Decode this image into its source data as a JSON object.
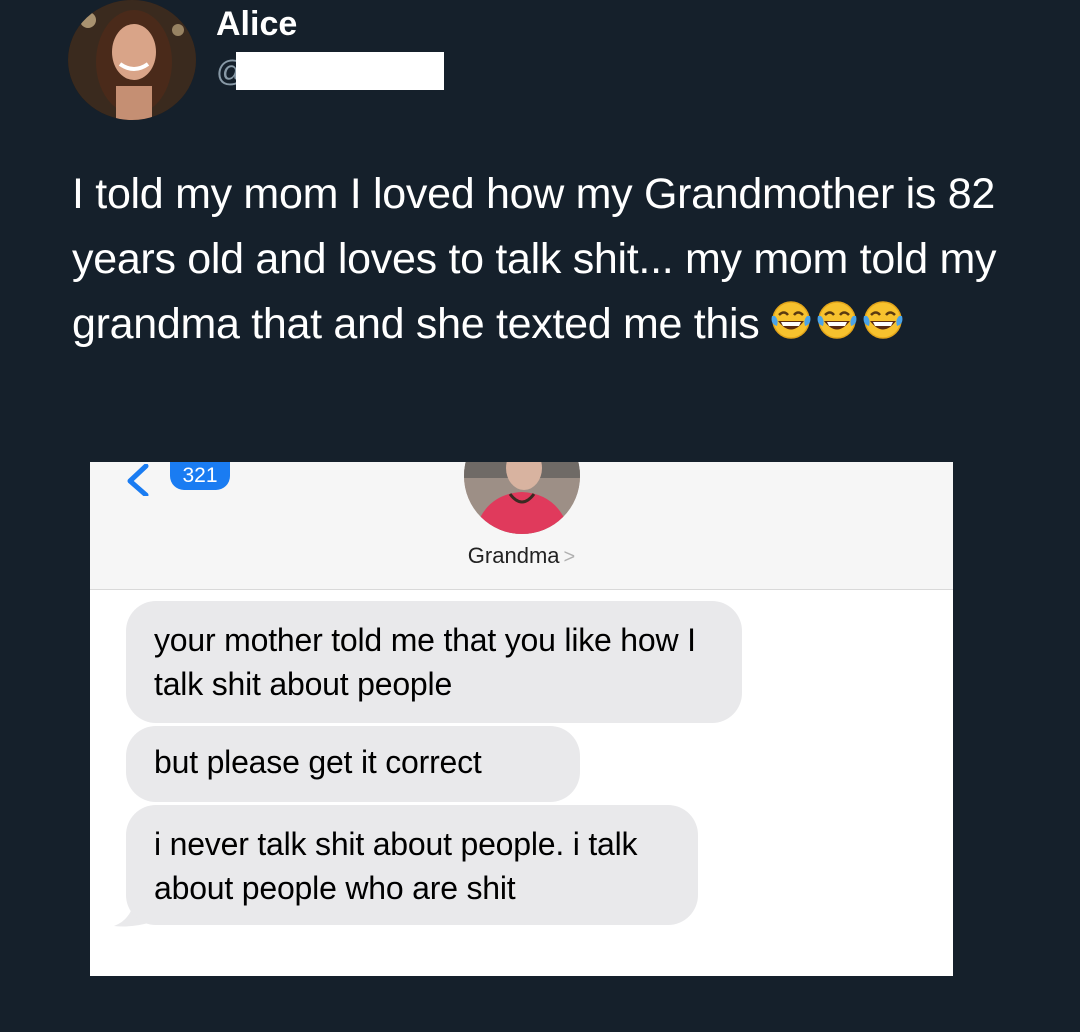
{
  "tweet": {
    "display_name": "Alice",
    "handle_prefix": "@",
    "text": "I told my mom I loved how my Grandmother is 82 years old and loves to talk shit... my mom told my grandma that and she texted me this",
    "emoji_icon": "face-with-tears-of-joy-icon",
    "emoji_count": 3
  },
  "imessage": {
    "back_icon": "chevron-left-icon",
    "unread_count": "321",
    "contact_name": "Grandma",
    "contact_chevron": ">",
    "messages": [
      {
        "text": "your mother told me that you like how I talk shit about people"
      },
      {
        "text": "but please get it correct"
      },
      {
        "text": "i never talk shit about people. i talk about people who are shit"
      }
    ]
  },
  "colors": {
    "background": "#15202b",
    "text": "#ffffff",
    "handle": "#8899a6",
    "badge": "#1a7cf2",
    "bubble": "#e9e9eb"
  }
}
